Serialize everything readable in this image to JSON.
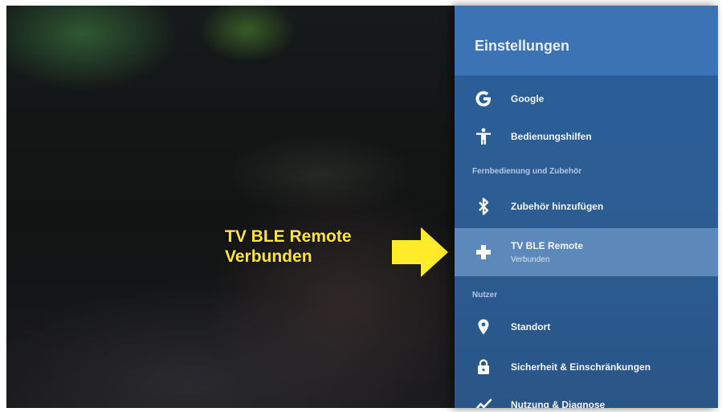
{
  "annotation": {
    "line1": "TV BLE Remote",
    "line2": "Verbunden",
    "color": "#ffe533"
  },
  "panel": {
    "title": "Einstellungen",
    "items": [
      {
        "label": "Google",
        "icon": "google-icon"
      },
      {
        "label": "Bedienungshilfen",
        "icon": "accessibility-icon"
      }
    ],
    "section_remote": "Fernbedienung und Zubehör",
    "remote_items": [
      {
        "label": "Zubehör hinzufügen",
        "icon": "bluetooth-icon"
      },
      {
        "label": "TV BLE Remote",
        "sublabel": "Verbunden",
        "icon": "gamepad-icon"
      }
    ],
    "section_user": "Nutzer",
    "user_items": [
      {
        "label": "Standort",
        "icon": "location-pin-icon"
      },
      {
        "label": "Sicherheit & Einschränkungen",
        "icon": "lock-icon"
      },
      {
        "label": "Nutzung & Diagnose",
        "icon": "activity-chart-icon"
      }
    ],
    "colors": {
      "panel_bg": "#2c5d93",
      "header_bg": "#3b73b5",
      "selected_bg": "#5d88ba"
    }
  }
}
